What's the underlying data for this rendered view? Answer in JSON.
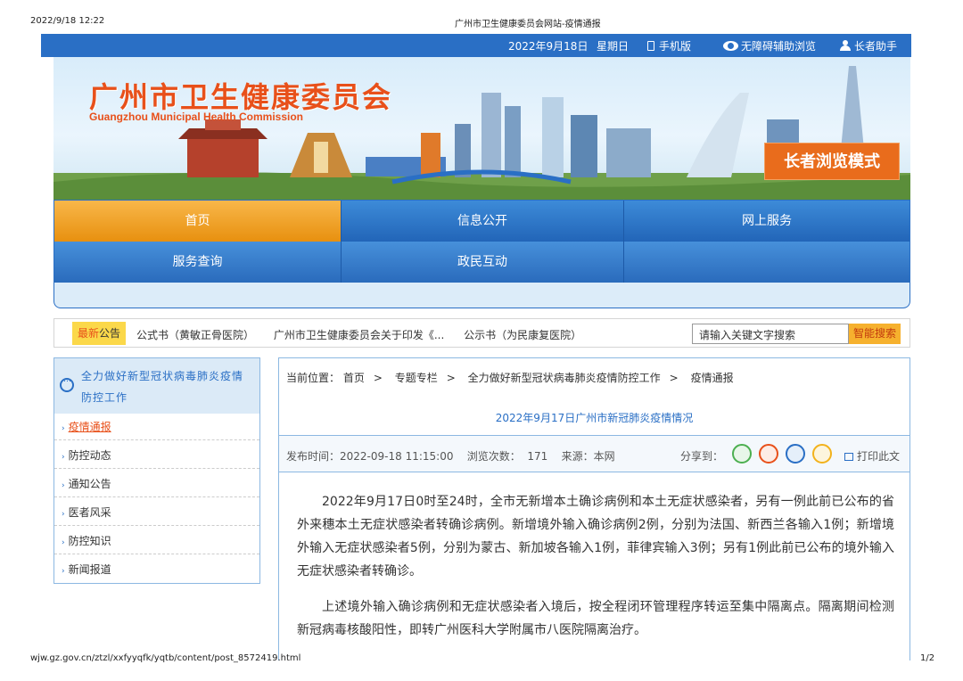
{
  "print_header": {
    "datetime": "2022/9/18 12:22",
    "title": "广州市卫生健康委员会网站-疫情通报"
  },
  "print_footer": {
    "url": "wjw.gz.gov.cn/ztzl/xxfyyqfk/yqtb/content/post_8572419.html",
    "page": "1/2"
  },
  "topbar": {
    "date": "2022年9月18日",
    "weekday": "星期日",
    "mobile": "手机版",
    "accessible": "无障碍辅助浏览",
    "elder": "长者助手"
  },
  "banner": {
    "name_cn": "广州市卫生健康委员会",
    "name_en": "Guangzhou Municipal Health Commission",
    "elder_mode": "长者浏览模式"
  },
  "nav": {
    "row1": [
      "首页",
      "信息公开",
      "网上服务"
    ],
    "row2": [
      "服务查询",
      "政民互动"
    ]
  },
  "notice": {
    "label_a": "最新",
    "label_b": "公告",
    "items": [
      "公式书（黄敏正骨医院）",
      "广州市卫生健康委员会关于印发《...",
      "公示书（为民康复医院）"
    ]
  },
  "search": {
    "placeholder": "请输入关键文字搜索",
    "button": "智能搜索"
  },
  "sidebar": {
    "heading": "全力做好新型冠状病毒肺炎疫情防控工作",
    "items": [
      "疫情通报",
      "防控动态",
      "通知公告",
      "医者风采",
      "防控知识",
      "新闻报道"
    ]
  },
  "breadcrumb": {
    "label": "当前位置：",
    "items": [
      "首页",
      "专题专栏",
      "全力做好新型冠状病毒肺炎疫情防控工作",
      "疫情通报"
    ]
  },
  "article": {
    "title": "2022年9月17日广州市新冠肺炎疫情情况",
    "published_label": "发布时间：",
    "published": "2022-09-18 11:15:00",
    "views_label": "浏览次数：",
    "views": "171",
    "source_label": "来源：",
    "source": "本网",
    "share_label": "分享到：",
    "print_label": "打印此文",
    "paragraphs": [
      "2022年9月17日0时至24时，全市无新增本土确诊病例和本土无症状感染者，另有一例此前已公布的省外来穗本土无症状感染者转确诊病例。新增境外输入确诊病例2例，分别为法国、新西兰各输入1例；新增境外输入无症状感染者5例，分别为蒙古、新加坡各输入1例，菲律宾输入3例；另有1例此前已公布的境外输入无症状感染者转确诊。",
      "上述境外输入确诊病例和无症状感染者入境后，按全程闭环管理程序转运至集中隔离点。隔离期间检测新冠病毒核酸阳性，即转广州医科大学附属市八医院隔离治疗。"
    ]
  },
  "colors": {
    "accent": "#2a6fc5",
    "orange": "#e8501a",
    "nav_active": "#f4a62a"
  }
}
